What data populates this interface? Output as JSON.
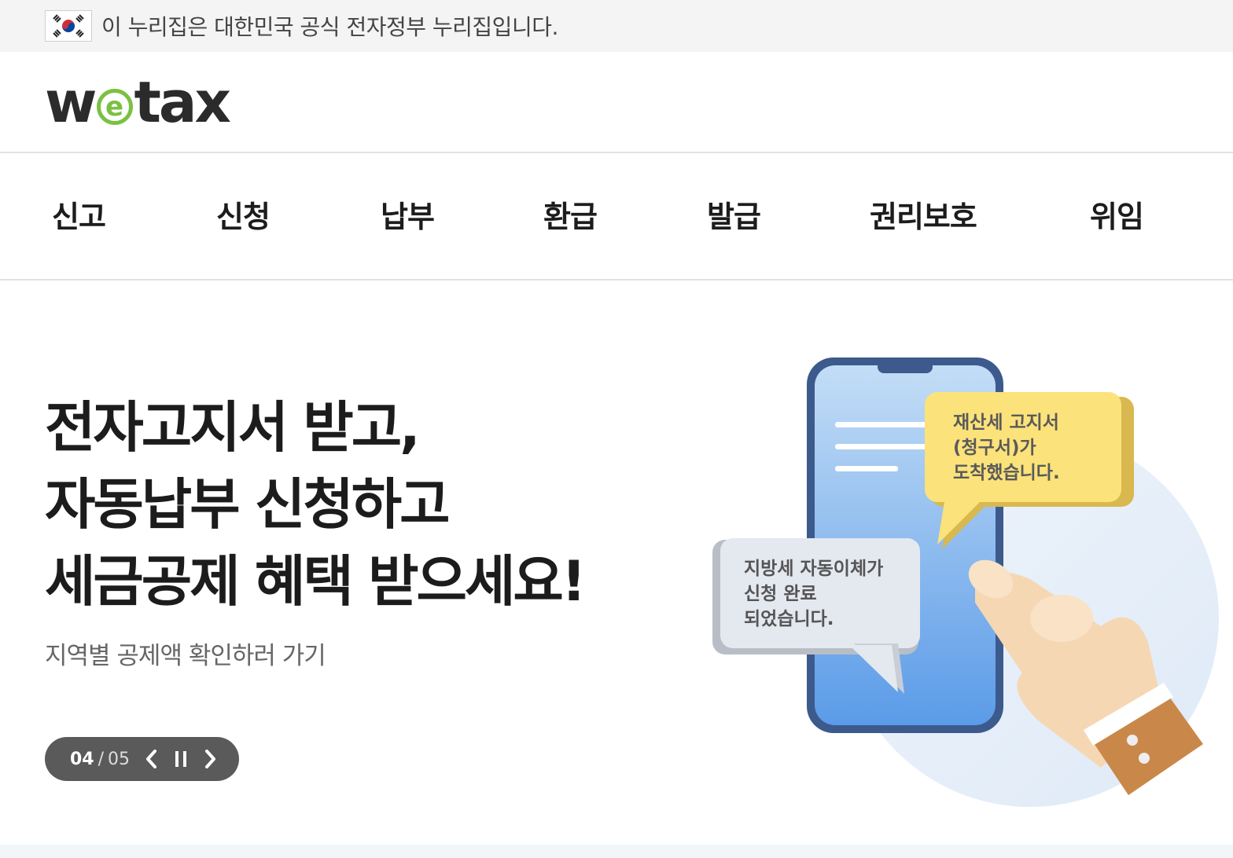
{
  "gov_banner": {
    "text": "이 누리집은 대한민국 공식 전자정부 누리집입니다.",
    "flag_icon": "korea-flag-icon"
  },
  "header": {
    "logo": {
      "w": "w",
      "e": "e",
      "tax": "tax"
    }
  },
  "gnb": {
    "items": [
      {
        "label": "신고"
      },
      {
        "label": "신청"
      },
      {
        "label": "납부"
      },
      {
        "label": "환급"
      },
      {
        "label": "발급"
      },
      {
        "label": "권리보호"
      },
      {
        "label": "위임"
      }
    ]
  },
  "hero": {
    "headline": [
      "전자고지서 받고,",
      "자동납부 신청하고",
      "세금공제 혜택 받으세요!"
    ],
    "sublink": "지역별 공제액 확인하러 가기",
    "slider": {
      "current": "04",
      "separator": "/",
      "total": "05",
      "prev_icon": "chevron-left-icon",
      "pause_icon": "pause-icon",
      "next_icon": "chevron-right-icon"
    },
    "illustration": {
      "bubble_yellow": [
        "재산세 고지서",
        "(청구서)가",
        "도착했습니다."
      ],
      "bubble_gray": [
        "지방세 자동이체가",
        "신청 완료",
        "되었습니다."
      ]
    }
  },
  "colors": {
    "logo_accent": "#7ac143",
    "slider_bg": "#5a5a5a",
    "phone_blue": "#6ea8ec",
    "bubble_yellow": "#fbe27a"
  }
}
